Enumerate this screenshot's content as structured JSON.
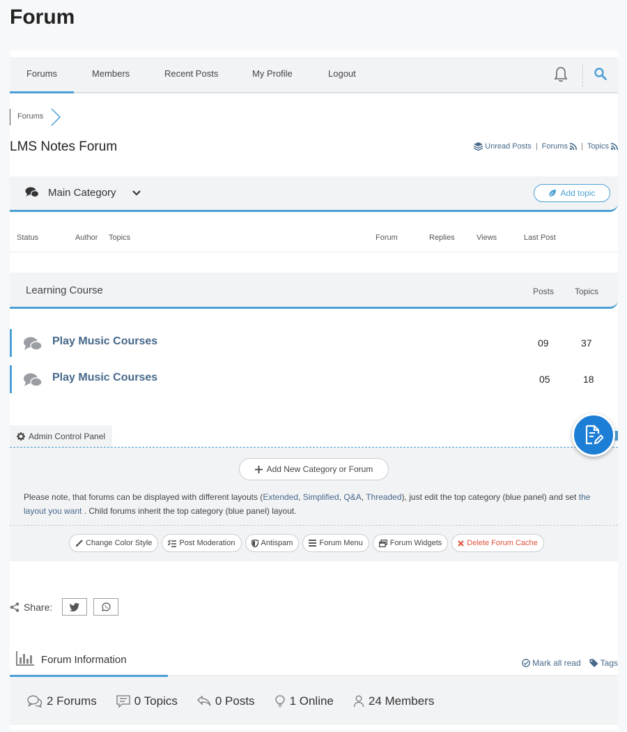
{
  "page_title": "Forum",
  "nav": {
    "items": [
      "Forums",
      "Members",
      "Recent Posts",
      "My Profile",
      "Logout"
    ],
    "active": "Forums"
  },
  "breadcrumb": {
    "item": "Forums"
  },
  "forum_title": "LMS Notes Forum",
  "top_links": {
    "unread": "Unread Posts",
    "forums": "Forums",
    "topics": "Topics",
    "sep": "|"
  },
  "category": {
    "title": "Main Category",
    "add_topic": "Add topic"
  },
  "columns": {
    "status": "Status",
    "author": "Author",
    "topics": "Topics",
    "forum": "Forum",
    "replies": "Replies",
    "views": "Views",
    "last_post": "Last Post"
  },
  "section": {
    "title": "Learning Course",
    "posts_label": "Posts",
    "topics_label": "Topics",
    "rows": [
      {
        "title": "Play Music Courses",
        "posts": "09",
        "topics": "37"
      },
      {
        "title": "Play Music Courses",
        "posts": "05",
        "topics": "18"
      }
    ]
  },
  "admin": {
    "tab": "Admin Control Panel",
    "add_button": "Add New Category or Forum",
    "note": {
      "p1": "Please note, that forums can be displayed with different layouts (",
      "l1": "Extended",
      "c1": ", ",
      "l2": "Simplified",
      "c2": ", ",
      "l3": "Q&A",
      "c3": ", ",
      "l4": "Threaded",
      "p2": "), just edit the top category (blue panel) and set ",
      "l5": "the layout you want",
      "p3": " . Child forums inherit the top category (blue panel) layout."
    },
    "tools": [
      "Change Color Style",
      "Post Moderation",
      "Antispam",
      "Forum Menu",
      "Forum Widgets",
      "Delete Forum Cache"
    ]
  },
  "share": {
    "label": "Share:"
  },
  "info": {
    "title": "Forum Information",
    "mark_all_read": "Mark all read",
    "tags": "Tags",
    "stats": {
      "forums": "2 Forums",
      "topics": "0 Topics",
      "posts": "0 Posts",
      "online": "1 Online",
      "members": "24 Members"
    }
  },
  "colors": {
    "accent": "#4a9fd5",
    "link": "#46688a",
    "fab": "#1d7ed6",
    "danger": "#e0513b"
  }
}
